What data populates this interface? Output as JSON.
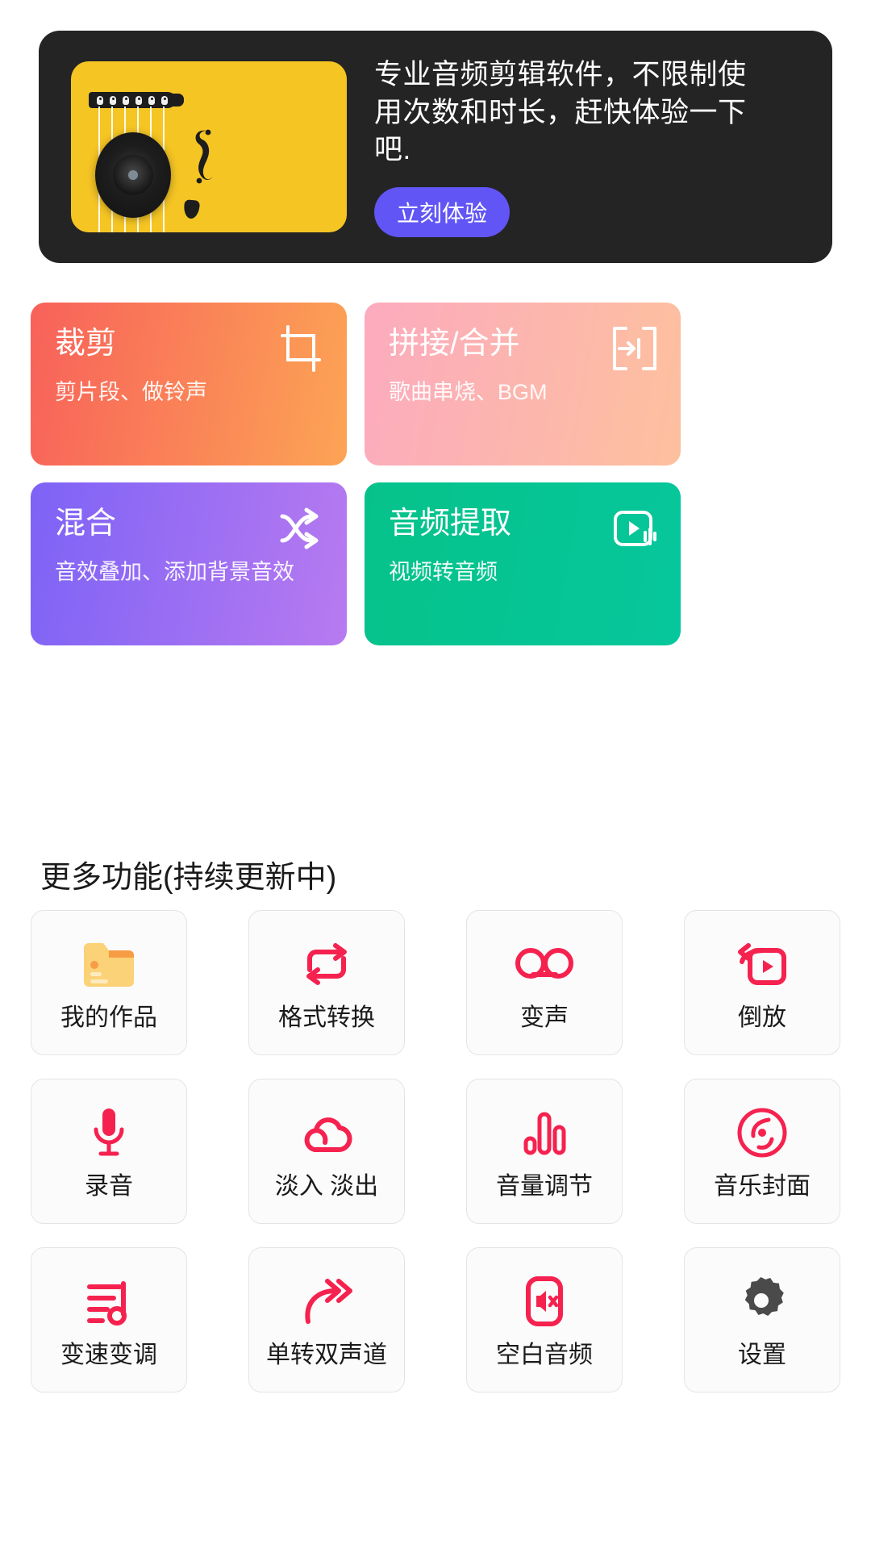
{
  "banner": {
    "promo_text": "专业音频剪辑软件，不限制使用次数和时长，赶快体验一下吧.",
    "cta_label": "立刻体验",
    "bg_color": "#242424",
    "cta_color": "#6155F5",
    "illustration": "acoustic-guitar"
  },
  "features": [
    {
      "title": "裁剪",
      "subtitle": "剪片段、做铃声",
      "icon": "crop-icon",
      "gradient": "#F8615A → #FCA455"
    },
    {
      "title": "拼接/合并",
      "subtitle": "歌曲串烧、BGM",
      "icon": "merge-icon",
      "gradient": "#FCABBE → #FDC09E"
    },
    {
      "title": "混合",
      "subtitle": "音效叠加、添加背景音效",
      "icon": "shuffle-icon",
      "gradient": "#7D63F6 → #B87AF0"
    },
    {
      "title": "音频提取",
      "subtitle": "视频转音频",
      "icon": "audio-extract-icon",
      "gradient": "#06C28A → #06C79C"
    }
  ],
  "more": {
    "heading": "更多功能(持续更新中)",
    "accent_color": "#F5224F",
    "items": [
      {
        "label": "我的作品",
        "icon": "folder-icon"
      },
      {
        "label": "格式转换",
        "icon": "convert-loop-icon"
      },
      {
        "label": "变声",
        "icon": "voice-changer-icon"
      },
      {
        "label": "倒放",
        "icon": "reverse-play-icon"
      },
      {
        "label": "录音",
        "icon": "microphone-icon"
      },
      {
        "label": "淡入 淡出",
        "icon": "cloud-fade-icon"
      },
      {
        "label": "音量调节",
        "icon": "volume-bars-icon"
      },
      {
        "label": "音乐封面",
        "icon": "music-disc-icon"
      },
      {
        "label": "变速变调",
        "icon": "tempo-pitch-icon"
      },
      {
        "label": "单转双声道",
        "icon": "stereo-convert-icon"
      },
      {
        "label": "空白音频",
        "icon": "mute-audio-icon"
      },
      {
        "label": "设置",
        "icon": "gear-icon"
      }
    ]
  }
}
